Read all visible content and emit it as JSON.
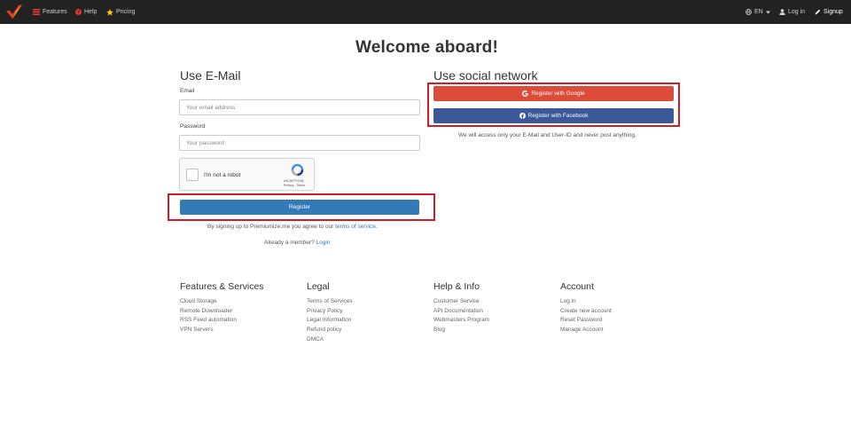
{
  "nav": {
    "features": "Features",
    "help": "Help",
    "pricing": "Pricing",
    "language": "EN",
    "login": "Log in",
    "signup": "Signup"
  },
  "page_title": "Welcome aboard!",
  "email_section": {
    "heading": "Use E-Mail",
    "email_label": "Email",
    "email_placeholder": "Your email address",
    "password_label": "Password",
    "password_placeholder": "Your password",
    "captcha": {
      "text": "I'm not a robot",
      "brand": "reCAPTCHA",
      "privacy": "Privacy",
      "terms": "Terms"
    },
    "register_button": "Register",
    "terms_note_prefix": "By signing up to Premiumize.me you agree to our",
    "terms_link": "terms of service",
    "terms_note_suffix": ".",
    "member_prefix": "Already a member?",
    "login_link": "Login"
  },
  "social_section": {
    "heading": "Use social network",
    "google_button": "Register with Google",
    "facebook_button": "Register with Facebook",
    "note": "We will access only your E-Mail and User-ID and never post anything."
  },
  "footer": {
    "features": {
      "title": "Features & Services",
      "links": [
        "Cloud Storage",
        "Remote Downloader",
        "RSS Feed automation",
        "VPN Servers"
      ]
    },
    "legal": {
      "title": "Legal",
      "links": [
        "Terms of Services",
        "Privacy Policy",
        "Legal Information",
        "Refund policy",
        "DMCA"
      ]
    },
    "help": {
      "title": "Help & Info",
      "links": [
        "Customer Service",
        "API Documentation",
        "Webmasters Program",
        "Blog"
      ]
    },
    "account": {
      "title": "Account",
      "links": [
        "Log in",
        "Create new account",
        "Reset Password",
        "Manage Account"
      ]
    }
  },
  "colors": {
    "navbar": "#222222",
    "register": "#337ab7",
    "google": "#dd4b39",
    "facebook": "#3b5998",
    "highlight": "#d11c24"
  }
}
